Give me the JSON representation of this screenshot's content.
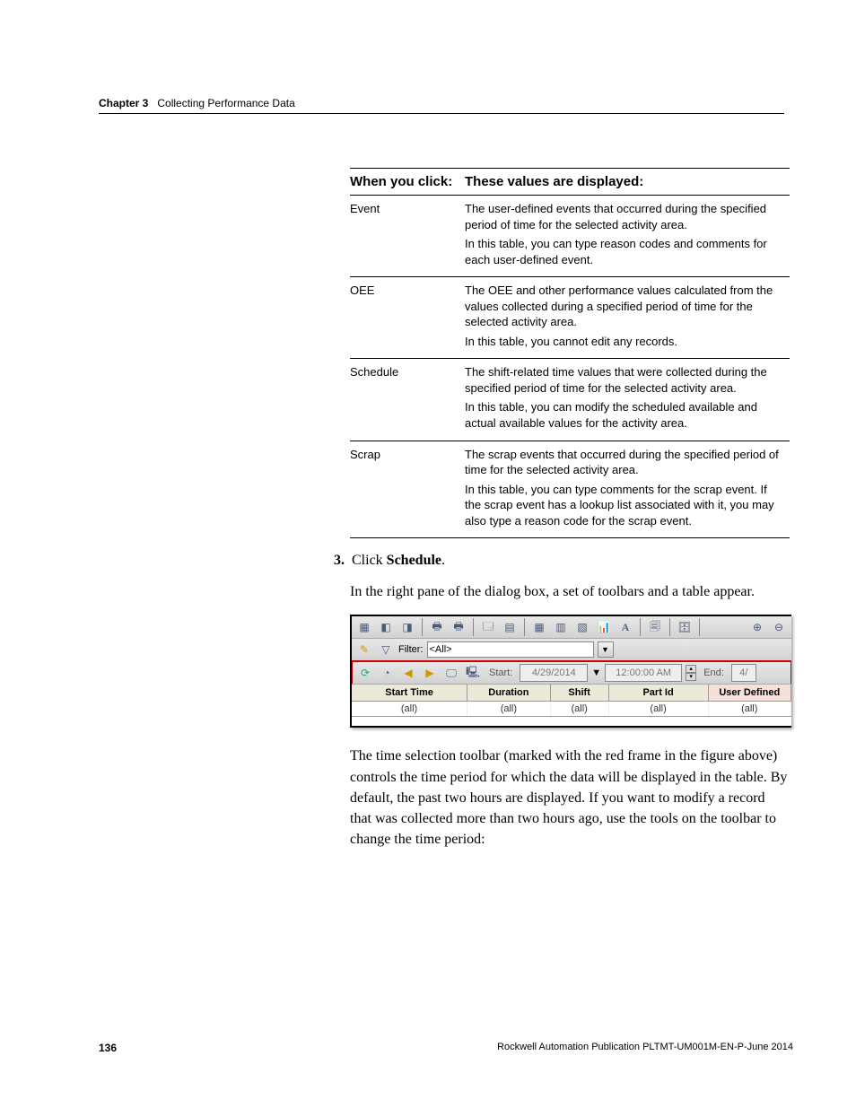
{
  "runningHead": {
    "chapterLabel": "Chapter 3",
    "chapterTitle": "Collecting Performance Data"
  },
  "table": {
    "header": {
      "c1": "When you click:",
      "c2": "These values are displayed:"
    },
    "rows": [
      {
        "label": "Event",
        "p1": "The user-defined events that occurred during the specified period of time for the selected activity area.",
        "p2": "In this table, you can type reason codes and comments for each user-defined event."
      },
      {
        "label": "OEE",
        "p1": "The OEE and other performance values calculated from the values collected during a specified period of time for the selected activity area.",
        "p2": "In this table, you cannot edit any records."
      },
      {
        "label": "Schedule",
        "p1": "The shift-related time values that were collected during the specified period of time for the selected activity area.",
        "p2": "In this table, you can modify the scheduled available and actual available values for the activity area."
      },
      {
        "label": "Scrap",
        "p1": "The scrap events that occurred during the specified period of time for the selected activity area.",
        "p2": "In this table, you can type comments for the scrap event. If the scrap event has a lookup list associated with it, you may also type a reason code for the scrap event."
      }
    ]
  },
  "step": {
    "num": "3.",
    "textPrefix": "Click ",
    "strong": "Schedule",
    "textSuffix": "."
  },
  "para1": "In the right pane of the dialog box, a set of toolbars and a table appear.",
  "uiShot": {
    "filterLabel": "Filter:",
    "filterValue": "<All>",
    "startLabel": "Start:",
    "dateValue": "4/29/2014",
    "timeValue": "12:00:00 AM",
    "endLabel": "End:",
    "endValue": "4/",
    "columns": [
      "Start Time",
      "Duration",
      "Shift",
      "Part Id",
      "User Defined"
    ],
    "filterRow": [
      "(all)",
      "(all)",
      "(all)",
      "(all)",
      "(all)"
    ]
  },
  "para2": "The time selection toolbar (marked with the red frame in the figure above) controls the time period for which the data will be displayed in the table. By default, the past two hours are displayed. If you want to modify a record that was collected more than two hours ago, use the tools on the toolbar to change the time period:",
  "footer": {
    "page": "136",
    "pub": "Rockwell Automation Publication PLTMT-UM001M-EN-P-June 2014"
  }
}
